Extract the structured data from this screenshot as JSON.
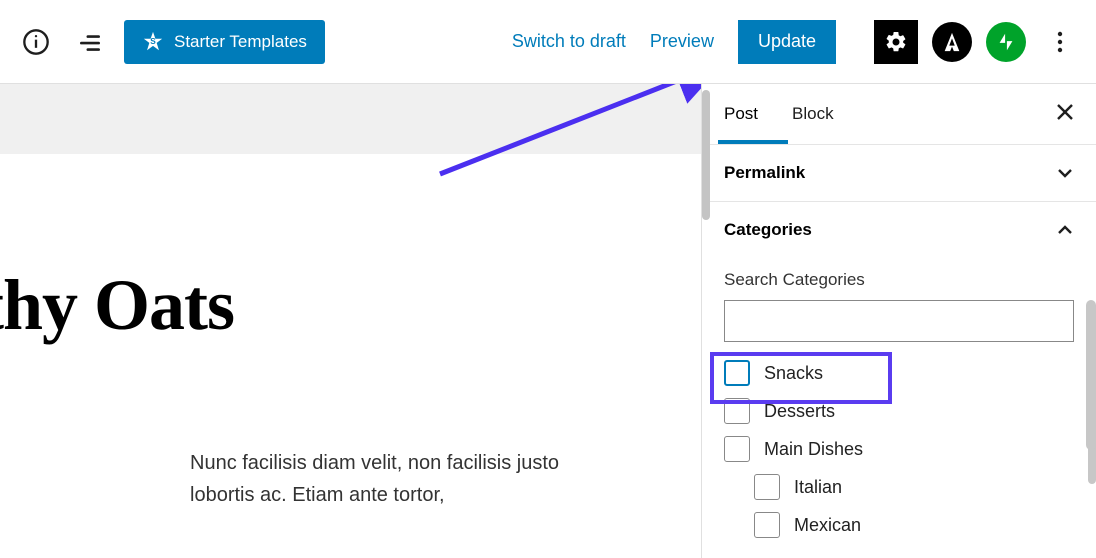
{
  "topbar": {
    "starter_label": "Starter Templates",
    "switch_draft": "Switch to draft",
    "preview": "Preview",
    "update": "Update"
  },
  "editor": {
    "title_fragment": "thy Oats",
    "paragraph": "Nunc facilisis diam velit, non facilisis justo lobortis ac. Etiam ante tortor,"
  },
  "sidebar": {
    "tabs": {
      "post": "Post",
      "block": "Block"
    },
    "permalink": "Permalink",
    "categories": {
      "heading": "Categories",
      "search_label": "Search Categories",
      "items": [
        {
          "label": "Snacks",
          "indent": false
        },
        {
          "label": "Desserts",
          "indent": false
        },
        {
          "label": "Main Dishes",
          "indent": false
        },
        {
          "label": "Italian",
          "indent": true
        },
        {
          "label": "Mexican",
          "indent": true
        }
      ]
    }
  }
}
